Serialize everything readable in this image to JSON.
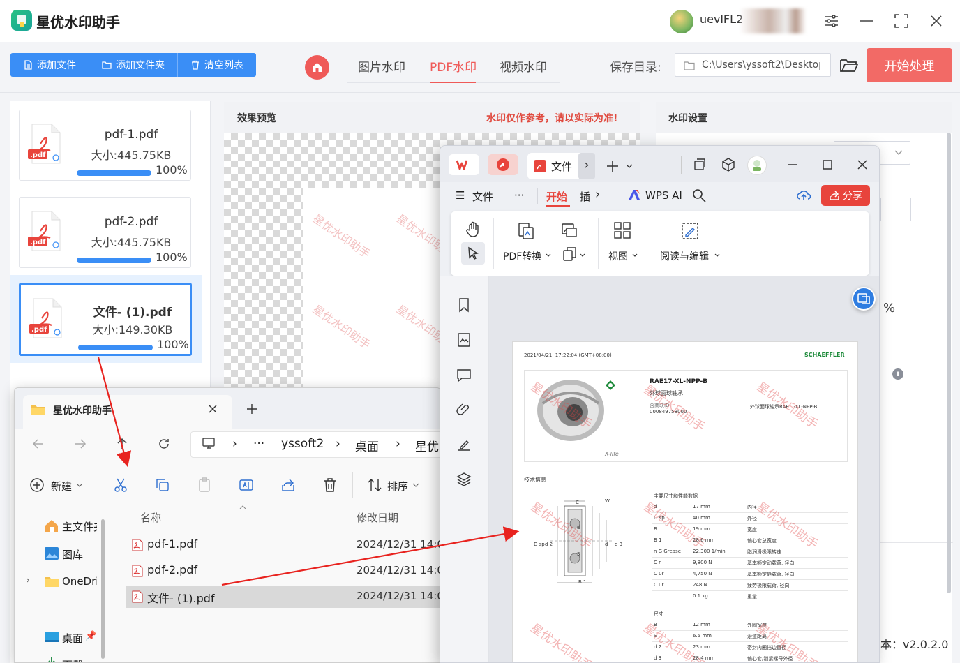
{
  "app": {
    "title": "星优水印助手",
    "user_name": "uevlFL2",
    "version": "本：v2.0.2.0"
  },
  "toolbar": {
    "add_file": "添加文件",
    "add_folder": "添加文件夹",
    "clear_list": "清空列表",
    "tabs": [
      "图片水印",
      "PDF水印",
      "视频水印"
    ],
    "active_tab": "PDF水印",
    "save_dir_label": "保存目录:",
    "save_dir_value": "C:\\Users\\yssoft2\\Desktop",
    "start_label": "开始处理"
  },
  "files": [
    {
      "name": "pdf-1.pdf",
      "size": "大小:445.75KB",
      "progress": "100%",
      "progress_value": 100
    },
    {
      "name": "pdf-2.pdf",
      "size": "大小:445.75KB",
      "progress": "100%",
      "progress_value": 100
    },
    {
      "name": "文件- (1).pdf",
      "size": "大小:149.30KB",
      "progress": "100%",
      "progress_value": 100,
      "selected": true
    }
  ],
  "preview": {
    "title": "效果预览",
    "warning": "水印仅作参考，请以实际为准!",
    "watermark_text": "星优水印助手"
  },
  "settings": {
    "title": "水印设置",
    "percent_sign": "%",
    "info_glyph": "i"
  },
  "explorer": {
    "tab_title": "星优水印助手",
    "breadcrumbs": [
      "yssoft2",
      "桌面",
      "星优"
    ],
    "ellipsis": "···",
    "new_label": "新建",
    "sort_label": "排序",
    "sidebar": [
      "主文件夹",
      "图库",
      "OneDrive",
      "桌面",
      "下载"
    ],
    "columns": {
      "name": "名称",
      "modified": "修改日期"
    },
    "rows": [
      {
        "name": "pdf-1.pdf",
        "date": "2024/12/31 14:0"
      },
      {
        "name": "pdf-2.pdf",
        "date": "2024/12/31 14:0"
      },
      {
        "name": "文件- (1).pdf",
        "date": "2024/12/31 14:0",
        "selected": true
      }
    ]
  },
  "wps": {
    "doc_tab": "文件",
    "menu": {
      "file": "文件",
      "more": "···",
      "start": "开始",
      "insert": "插",
      "ai": "WPS AI",
      "share": "分享"
    },
    "ribbon": {
      "pdf_convert": "PDF转换",
      "view": "视图",
      "read_edit": "阅读与编辑"
    },
    "page": {
      "timestamp": "2021/04/21, 17:22:04 (GMT+08:00)",
      "brand": "SCHAEFFLER",
      "product": "RAE17-XL-NPP-B",
      "product_cn": "外球面球轴承",
      "order_label": "含商联ID:",
      "order_no": "000849758000",
      "desc_right": "外球面球轴承RAE...-XL-NPP-B",
      "xlife": "X-life",
      "tech_info": "技术信息",
      "spec_title": "主要尺寸和性能数据",
      "dims_title": "尺寸",
      "specs": [
        {
          "k": "d",
          "v": "17  mm",
          "d": "内径"
        },
        {
          "k": "D sp",
          "v": "40  mm",
          "d": "外径"
        },
        {
          "k": "B",
          "v": "19  mm",
          "d": "宽度"
        },
        {
          "k": "B 1",
          "v": "28.6  mm",
          "d": "偏心套总宽度"
        },
        {
          "k": "n G Grease",
          "v": "22,300  1/min",
          "d": "脂润滑极限转速"
        },
        {
          "k": "C r",
          "v": "9,800  N",
          "d": "基本额定动载荷, 径向"
        },
        {
          "k": "C 0r",
          "v": "4,750  N",
          "d": "基本额定静载荷, 径向"
        },
        {
          "k": "C ur",
          "v": "248  N",
          "d": "疲劳极限载荷, 径向"
        },
        {
          "k": "",
          "v": "0.1  kg",
          "d": "重量"
        }
      ],
      "dims": [
        {
          "k": "B",
          "v": "12  mm",
          "d": "外圈宽度"
        },
        {
          "k": "S",
          "v": "6.5  mm",
          "d": "滚道距离"
        },
        {
          "k": "d 2",
          "v": "23  mm",
          "d": "密封内圈挡边直径"
        },
        {
          "k": "d 3",
          "v": "28.4  mm",
          "d": "偏心套/锁紧螺母外径"
        }
      ],
      "diagram_labels": [
        "C",
        "W",
        "B",
        "S",
        "D sp",
        "d 2",
        "d",
        "d 3",
        "B 1"
      ]
    }
  },
  "colors": {
    "accent_blue": "#3a8ef6",
    "accent_red": "#ef5a58",
    "start_button": "#f26a66",
    "wps_red": "#e8443c"
  }
}
